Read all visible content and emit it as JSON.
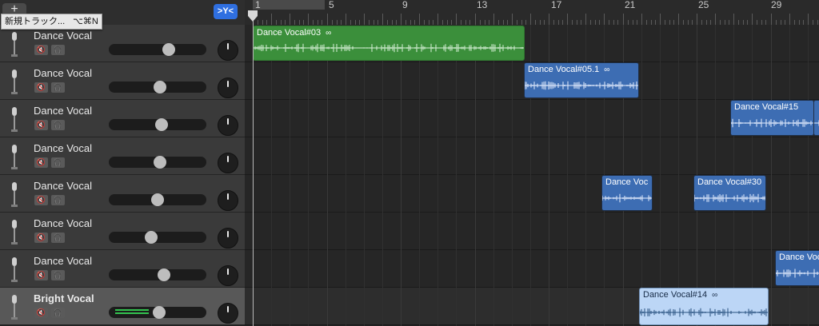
{
  "toolbar": {
    "add_label": "+",
    "tooltip_text": "新規トラック...",
    "tooltip_shortcut": "⌥⌘N",
    "filter_label": ">Y<"
  },
  "ruler": {
    "bars": [
      "1",
      "5",
      "9",
      "13",
      "17",
      "21",
      "25",
      "29"
    ]
  },
  "tracks": [
    {
      "name": "Dance Vocal",
      "mute": "🔇",
      "solo": "🎧"
    },
    {
      "name": "Dance Vocal",
      "mute": "🔇",
      "solo": "🎧"
    },
    {
      "name": "Dance Vocal",
      "mute": "🔇",
      "solo": "🎧"
    },
    {
      "name": "Dance Vocal",
      "mute": "🔇",
      "solo": "🎧"
    },
    {
      "name": "Dance Vocal",
      "mute": "🔇",
      "solo": "🎧"
    },
    {
      "name": "Dance Vocal",
      "mute": "🔇",
      "solo": "🎧"
    },
    {
      "name": "Dance Vocal",
      "mute": "🔇",
      "solo": "🎧"
    },
    {
      "name": "Bright Vocal",
      "mute": "🔇",
      "solo": "🎧"
    }
  ],
  "volume_levels": [
    0.63,
    0.53,
    0.55,
    0.53,
    0.5,
    0.42,
    0.58,
    0.52
  ],
  "selected_track": "Bright Vocal",
  "regions": [
    {
      "title": "Dance Vocal#03",
      "loop_icon": "loop-icon",
      "color": "#3b8f3b"
    },
    {
      "title": "Dance Vocal#05.1",
      "loop_icon": "loop-icon",
      "color": "#3d6db3"
    },
    {
      "title": "Dance Vocal#15",
      "color": "#3d6db3"
    },
    {
      "title": "Dance Voc",
      "color": "#3d6db3"
    },
    {
      "title": "Dance Vocal#30",
      "color": "#3d6db3"
    },
    {
      "title": "Dance Voc",
      "color": "#3d6db3"
    },
    {
      "title": "Dance Vocal#14",
      "loop_icon": "loop-icon",
      "color": "#bcd6f6"
    }
  ],
  "colors": {
    "accent": "#2f6fe0",
    "audio_region": "#3d6db3",
    "loop_region": "#3b8f3b",
    "selected_region": "#bcd6f6",
    "meter": "#32c24f"
  }
}
